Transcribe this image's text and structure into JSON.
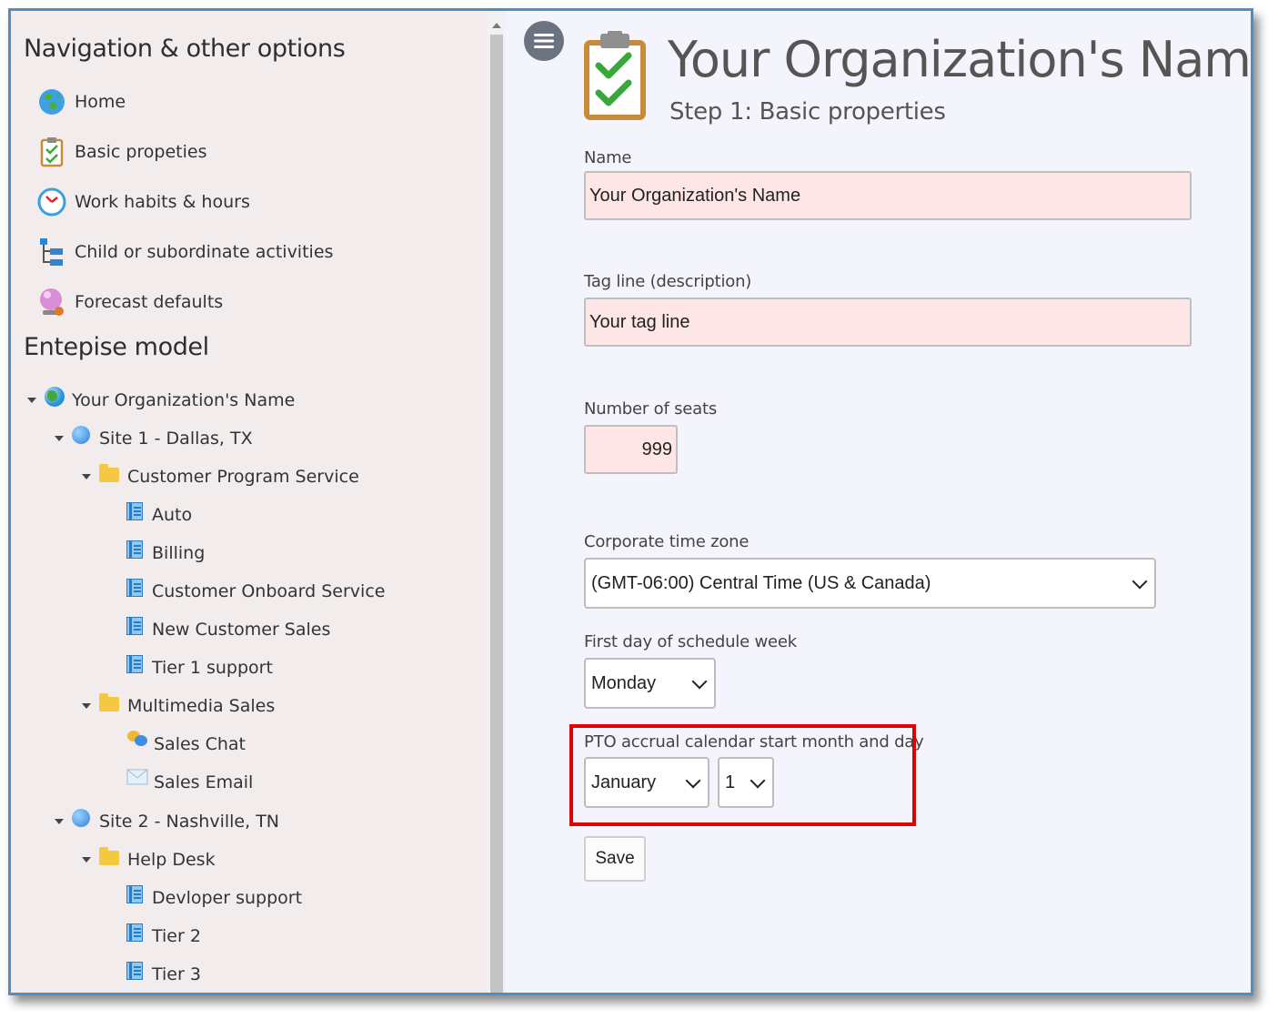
{
  "nav": {
    "heading": "Navigation & other options",
    "items": [
      {
        "label": "Home",
        "icon": "globe-icon"
      },
      {
        "label": "Basic propeties",
        "icon": "clipboard-icon"
      },
      {
        "label": "Work habits & hours",
        "icon": "clock-icon"
      },
      {
        "label": "Child or subordinate activities",
        "icon": "hierarchy-icon"
      },
      {
        "label": "Forecast defaults",
        "icon": "crystal-ball-icon"
      }
    ]
  },
  "tree": {
    "heading": "Entepise model",
    "root": "Your Organization's Name",
    "site1": {
      "label": "Site 1 - Dallas, TX",
      "group1": {
        "label": "Customer Program Service",
        "items": [
          "Auto",
          "Billing",
          "Customer Onboard Service",
          "New Customer Sales",
          "Tier 1 support"
        ]
      },
      "group2": {
        "label": "Multimedia Sales",
        "items": [
          "Sales Chat",
          "Sales Email"
        ]
      }
    },
    "site2": {
      "label": "Site 2 - Nashville, TN",
      "group1": {
        "label": "Help Desk",
        "items": [
          "Devloper support",
          "Tier 2",
          "Tier 3"
        ]
      }
    }
  },
  "header": {
    "title": "Your Organization's Name",
    "subtitle": "Step 1: Basic properties"
  },
  "form": {
    "name_label": "Name",
    "name_value": "Your Organization's Name",
    "tagline_label": "Tag line (description)",
    "tagline_value": "Your tag line",
    "seats_label": "Number of seats",
    "seats_value": "999",
    "timezone_label": "Corporate time zone",
    "timezone_value": "(GMT-06:00) Central Time (US & Canada)",
    "firstday_label": "First day of schedule week",
    "firstday_value": "Monday",
    "pto_label": "PTO accrual calendar start month and day",
    "pto_month": "January",
    "pto_day": "1",
    "save_label": "Save"
  },
  "colors": {
    "frame_border": "#4a90c8",
    "highlight_box": "#e00000",
    "input_bg": "#ffe6e6",
    "left_bg": "#f3ecec",
    "right_bg": "#f4f4fc"
  }
}
